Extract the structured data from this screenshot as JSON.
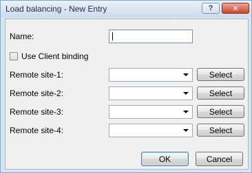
{
  "window": {
    "title": "Load balancing - New Entry",
    "help_label": "?",
    "close_label": "✕"
  },
  "form": {
    "name_label": "Name:",
    "name_value": "",
    "use_client_binding_label": "Use Client binding",
    "use_client_binding_checked": false,
    "remote_sites": [
      {
        "label": "Remote site-1:",
        "value": "",
        "button": "Select"
      },
      {
        "label": "Remote site-2:",
        "value": "",
        "button": "Select"
      },
      {
        "label": "Remote site-3:",
        "value": "",
        "button": "Select"
      },
      {
        "label": "Remote site-4:",
        "value": "",
        "button": "Select"
      }
    ]
  },
  "footer": {
    "ok_label": "OK",
    "cancel_label": "Cancel"
  }
}
